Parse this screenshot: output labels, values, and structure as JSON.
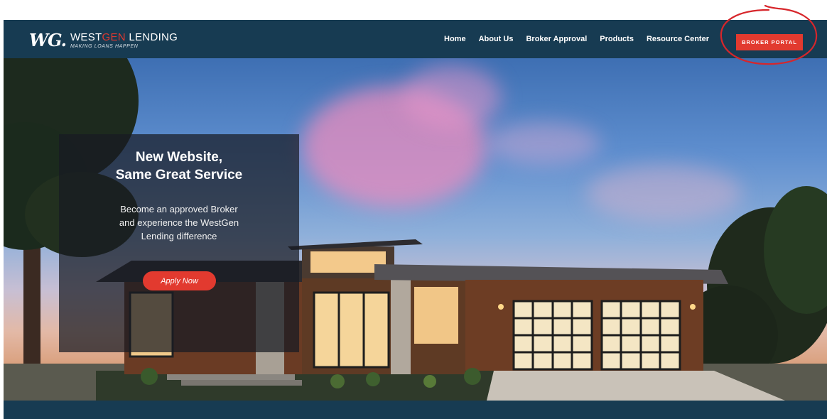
{
  "brand": {
    "mark": "WG.",
    "name_part1": "WEST",
    "name_part2": "GEN",
    "name_part3": " LENDING",
    "tagline": "MAKING LOANS HAPPEN"
  },
  "nav": {
    "items": [
      {
        "label": "Home"
      },
      {
        "label": "About Us"
      },
      {
        "label": "Broker Approval"
      },
      {
        "label": "Products"
      },
      {
        "label": "Resource Center"
      }
    ],
    "portal_button": "BROKER PORTAL"
  },
  "hero": {
    "title_line1": "New Website,",
    "title_line2": "Same Great Service",
    "text_line1": "Become an approved Broker",
    "text_line2": "and experience the WestGen",
    "text_line3": "Lending difference",
    "cta": "Apply Now"
  },
  "colors": {
    "header": "#173b52",
    "accent": "#e23a2f",
    "annotation": "#d7262b"
  },
  "icons": {
    "annotation": "red-circle-annotation"
  }
}
